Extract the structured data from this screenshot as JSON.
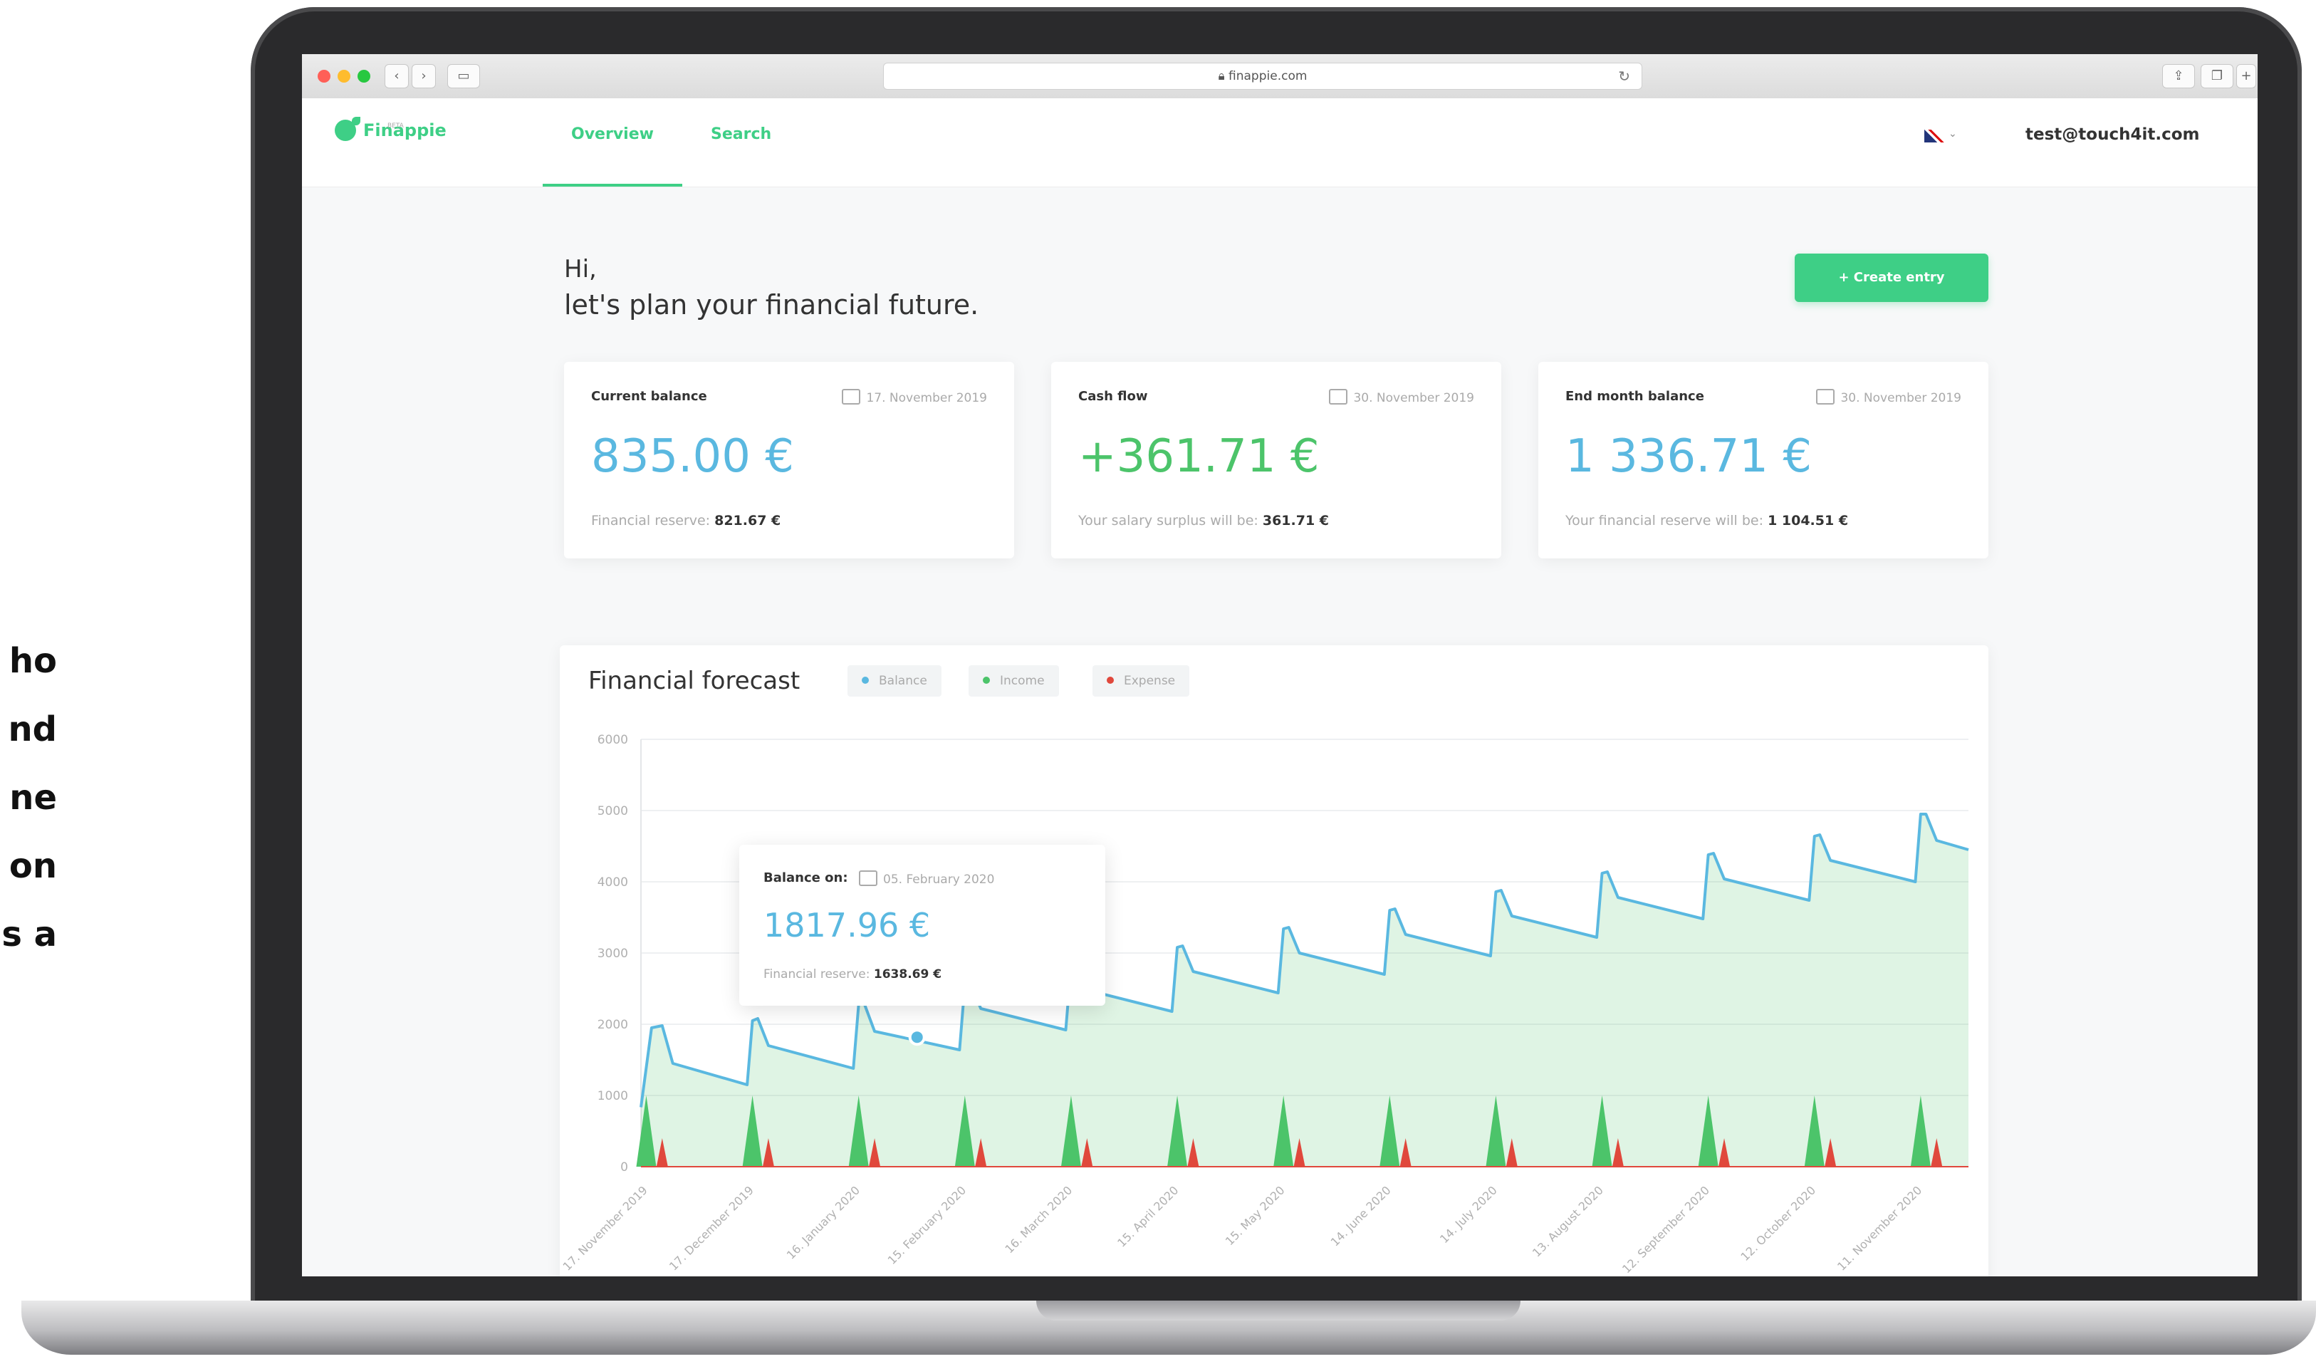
{
  "side_text": [
    "ho",
    "nd",
    "ne",
    "on",
    "s a"
  ],
  "browser": {
    "url": "finappie.com"
  },
  "app": {
    "logo_text": "Finappie",
    "logo_sub": "BETA",
    "tabs": [
      "Overview",
      "Search"
    ],
    "user_email": "test@touch4it.com"
  },
  "greeting": {
    "line1": "Hi,",
    "line2": "let's plan your financial future."
  },
  "create_entry_label": "+ Create entry",
  "cards": [
    {
      "title": "Current balance",
      "date": "17. November 2019",
      "value": "835.00 €",
      "value_color": "#5ab8e0",
      "sub_label": "Financial reserve:",
      "sub_value": "821.67 €"
    },
    {
      "title": "Cash flow",
      "date": "30. November 2019",
      "value": "+361.71 €",
      "value_color": "#4cc46a",
      "sub_label": "Your salary surplus will be:",
      "sub_value": "361.71 €"
    },
    {
      "title": "End month balance",
      "date": "30. November 2019",
      "value": "1 336.71 €",
      "value_color": "#5ab8e0",
      "sub_label": "Your financial reserve will be:",
      "sub_value": "1 104.51 €"
    }
  ],
  "forecast": {
    "title": "Financial forecast",
    "legend": [
      {
        "name": "Balance",
        "color": "#5ab8e0"
      },
      {
        "name": "Income",
        "color": "#4cc46a"
      },
      {
        "name": "Expense",
        "color": "#e0483c"
      }
    ]
  },
  "tooltip": {
    "title": "Balance on:",
    "date": "05. February 2020",
    "value": "1817.96 €",
    "sub_label": "Financial reserve:",
    "sub_value": "1638.69 €"
  },
  "chart_data": {
    "type": "area",
    "title": "Financial forecast",
    "ylim": [
      0,
      6000
    ],
    "y_ticks": [
      0,
      1000,
      2000,
      3000,
      4000,
      5000,
      6000
    ],
    "x_tick_labels": [
      "17. November 2019",
      "17. December 2019",
      "16. January 2020",
      "15. February 2020",
      "16. March 2020",
      "15. April 2020",
      "15. May 2020",
      "14. June 2020",
      "14. July 2020",
      "13. August 2020",
      "12. September 2020",
      "12. October 2020",
      "11. November 2020"
    ],
    "series": [
      {
        "name": "Balance",
        "points": [
          [
            0,
            835
          ],
          [
            0.1,
            1950
          ],
          [
            0.2,
            1980
          ],
          [
            0.3,
            1450
          ],
          [
            1,
            1150
          ],
          [
            1.05,
            2050
          ],
          [
            1.1,
            2080
          ],
          [
            1.2,
            1700
          ],
          [
            2,
            1380
          ],
          [
            2.05,
            2280
          ],
          [
            2.1,
            2300
          ],
          [
            2.2,
            1900
          ],
          [
            3,
            1640
          ],
          [
            3.05,
            2560
          ],
          [
            3.1,
            2580
          ],
          [
            3.2,
            2220
          ],
          [
            4,
            1920
          ],
          [
            4.05,
            2820
          ],
          [
            4.1,
            2840
          ],
          [
            4.2,
            2480
          ],
          [
            5,
            2180
          ],
          [
            5.05,
            3080
          ],
          [
            5.1,
            3100
          ],
          [
            5.2,
            2740
          ],
          [
            6,
            2440
          ],
          [
            6.05,
            3340
          ],
          [
            6.1,
            3360
          ],
          [
            6.2,
            3000
          ],
          [
            7,
            2700
          ],
          [
            7.05,
            3600
          ],
          [
            7.1,
            3620
          ],
          [
            7.2,
            3260
          ],
          [
            8,
            2960
          ],
          [
            8.05,
            3860
          ],
          [
            8.1,
            3880
          ],
          [
            8.2,
            3520
          ],
          [
            9,
            3220
          ],
          [
            9.05,
            4120
          ],
          [
            9.1,
            4140
          ],
          [
            9.2,
            3780
          ],
          [
            10,
            3480
          ],
          [
            10.05,
            4380
          ],
          [
            10.1,
            4400
          ],
          [
            10.2,
            4040
          ],
          [
            11,
            3740
          ],
          [
            11.05,
            4640
          ],
          [
            11.1,
            4660
          ],
          [
            11.2,
            4300
          ],
          [
            12,
            4000
          ],
          [
            12.05,
            4950
          ],
          [
            12.1,
            4950
          ],
          [
            12.2,
            4580
          ],
          [
            12.5,
            4450
          ]
        ]
      },
      {
        "name": "Income",
        "spikes": [
          0.05,
          1.05,
          2.05,
          3.05,
          4.05,
          5.05,
          6.05,
          7.05,
          8.05,
          9.05,
          10.05,
          11.05,
          12.05
        ],
        "values": [
          1000,
          1000,
          1000,
          1000,
          1000,
          1000,
          1000,
          1000,
          1000,
          1000,
          1000,
          1000,
          1000
        ]
      },
      {
        "name": "Expense",
        "spikes": [
          0.2,
          1.2,
          2.2,
          3.2,
          4.2,
          5.2,
          6.2,
          7.2,
          8.2,
          9.2,
          10.2,
          11.2,
          12.2
        ],
        "values": [
          400,
          400,
          400,
          400,
          400,
          400,
          400,
          400,
          400,
          400,
          400,
          400,
          400
        ]
      }
    ],
    "highlight": {
      "x": 2.6,
      "y": 1818
    }
  }
}
